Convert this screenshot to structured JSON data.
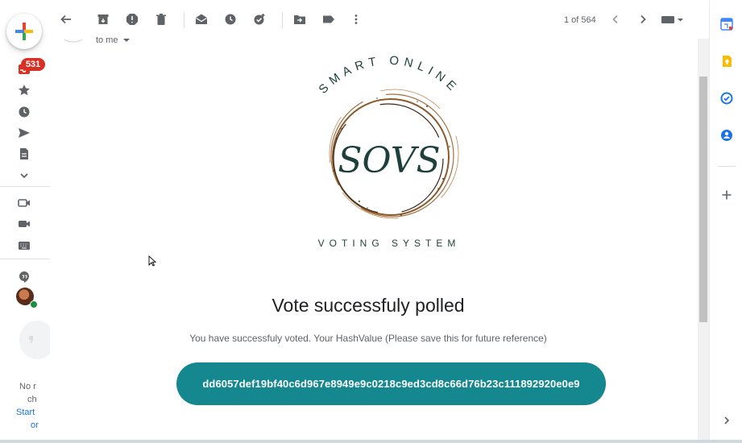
{
  "left_rail": {
    "unread_badge": "531",
    "hangouts_text": [
      "No r",
      "ch",
      "Start",
      "or"
    ]
  },
  "toolbar": {
    "pager": "1 of 564"
  },
  "message": {
    "recipient": "to me",
    "logo": {
      "top_text": "SMART ONLINE",
      "monogram": "SOVS",
      "bottom_text": "VOTING SYSTEM"
    },
    "headline": "Vote successfuly polled",
    "subtext": "You have successfuly voted. Your HashValue (Please save this for future reference)",
    "hash_value": "dd6057def19bf40c6d967e8949e9c0218c9ed3cd8c66d76b23c111892920e0e9"
  },
  "colors": {
    "hash_button": "#14878f",
    "badge": "#d93025",
    "logo_ink": "#1f3f3a",
    "logo_ring": "#8b5a2b"
  }
}
